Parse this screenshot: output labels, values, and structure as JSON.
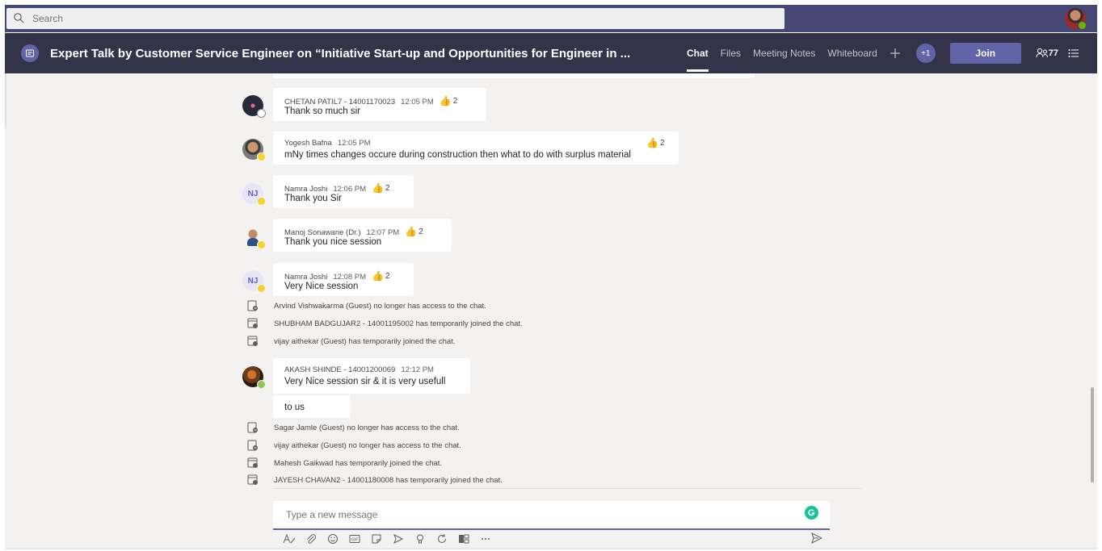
{
  "search": {
    "placeholder": "Search"
  },
  "header": {
    "title": "Expert Talk by Customer Service Engineer on “Initiative Start-up and Opportunities for Engineer in ...",
    "tabs": [
      "Chat",
      "Files",
      "Meeting Notes",
      "Whiteboard"
    ],
    "active_tab": "Chat",
    "plus_one": "+1",
    "join_label": "Join",
    "participants_count": "77"
  },
  "messages": [
    {
      "author": "CHETAN PATIL7 - 14001170023",
      "time": "12:05 PM",
      "text": "Thank so much sir",
      "reactions": "2",
      "avatar": "photo",
      "status": "offline"
    },
    {
      "author": "Yogesh Bafna",
      "time": "12:05 PM",
      "text": "mNy times changes occure during construction then what to do with surplus material",
      "reactions": "2",
      "avatar": "photo",
      "status": "away"
    },
    {
      "author": "Namra Joshi",
      "time": "12:06 PM",
      "text": "Thank you Sir",
      "reactions": "2",
      "avatar_initials": "NJ",
      "status": "away"
    },
    {
      "author": "Manoj Sonawane (Dr.)",
      "time": "12:07 PM",
      "text": "Thank you nice session",
      "reactions": "2",
      "avatar": "photo",
      "status": "away"
    },
    {
      "author": "Namra Joshi",
      "time": "12:08 PM",
      "text": "Very Nice session",
      "reactions": "2",
      "avatar_initials": "NJ",
      "status": "away"
    },
    {
      "author": "AKASH SHINDE - 14001200069",
      "time": "12:12 PM",
      "text": "Very Nice session sir & it is very usefull",
      "continued": "to us",
      "avatar": "photo",
      "status": "online"
    }
  ],
  "system_events": [
    {
      "text": "Arvind Vishwakarma (Guest) no longer has access to the chat.",
      "type": "left"
    },
    {
      "text": "SHUBHAM BADGUJAR2 - 14001195002 has temporarily joined the chat.",
      "type": "joined"
    },
    {
      "text": "vijay aithekar (Guest) has temporarily joined the chat.",
      "type": "joined"
    },
    {
      "text": "Sagar Jamle (Guest) no longer has access to the chat.",
      "type": "left"
    },
    {
      "text": "vijay aithekar (Guest) no longer has access to the chat.",
      "type": "left"
    },
    {
      "text": "Mahesh Gaikwad has temporarily joined the chat.",
      "type": "joined"
    },
    {
      "text": "JAYESH CHAVAN2 - 14001180008 has temporarily joined the chat.",
      "type": "joined"
    }
  ],
  "compose": {
    "placeholder": "Type a new message",
    "tools": [
      "format-icon",
      "attach-icon",
      "emoji-icon",
      "gif-icon",
      "sticker-icon",
      "meet-now-icon",
      "praise-icon",
      "loop-icon",
      "stream-icon",
      "more-icon"
    ]
  },
  "colors": {
    "accent": "#6264a7",
    "header_bg": "#33344a",
    "topbar_bg": "#464775",
    "chat_bg": "#f3f2f1",
    "grammarly": "#15c39a"
  }
}
